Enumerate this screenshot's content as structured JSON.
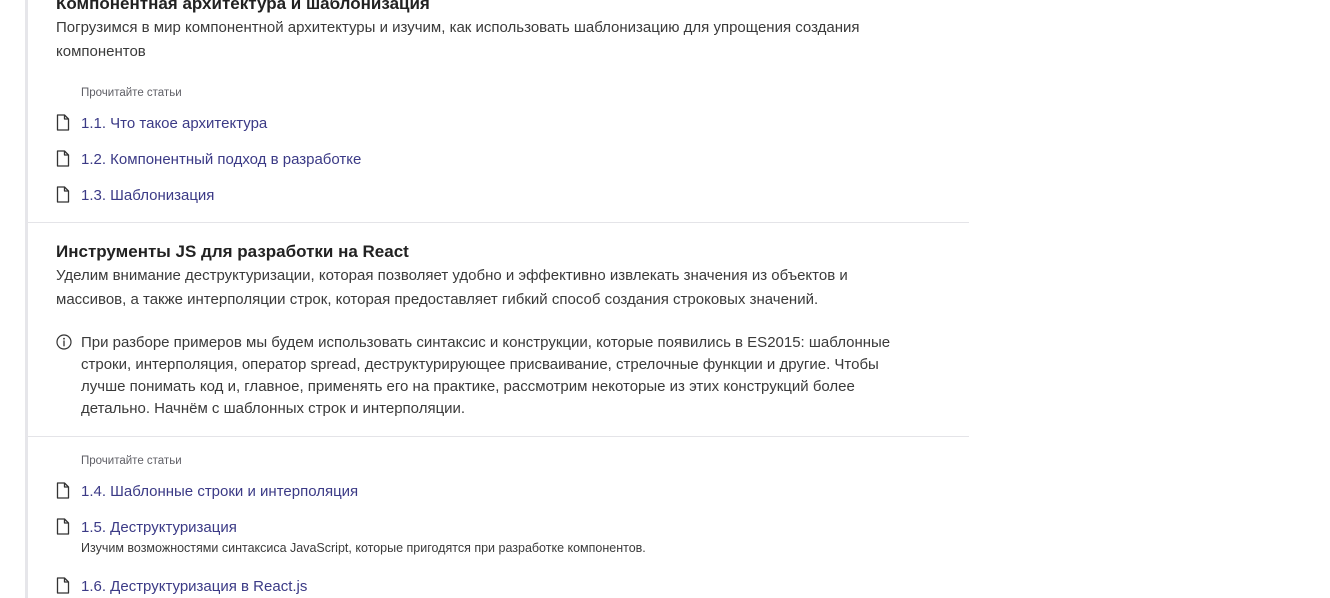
{
  "sections": [
    {
      "title": "Компонентная архитектура и шаблонизация",
      "description_lines": [
        "Погрузимся в мир компонентной архитектуры и изучим, как использовать шаблонизацию для упрощения создания",
        "компонентов"
      ],
      "read_label": "Прочитайте статьи",
      "articles": [
        {
          "title": "1.1. Что такое архитектура",
          "icon": "document-icon"
        },
        {
          "title": "1.2. Компонентный подход в разработке",
          "icon": "document-icon"
        },
        {
          "title": "1.3. Шаблонизация",
          "icon": "document-icon"
        }
      ]
    },
    {
      "title": "Инструменты JS для разработки на React",
      "description_lines": [
        "Уделим внимание деструктуризации, которая позволяет удобно и эффективно извлекать значения из объектов и",
        "массивов, а также интерполяции строк, которая предоставляет гибкий способ создания строковых значений."
      ],
      "note": {
        "icon": "info-icon",
        "lines": [
          "При разборе примеров мы будем использовать синтаксис и конструкции, которые появились в ES2015: шаблонные",
          "строки, интерполяция, оператор spread, деструктурирующее присваивание, стрелочные функции и другие. Чтобы",
          "лучше понимать код и, главное, применять его на практике, рассмотрим некоторые из этих конструкций более",
          "детально. Начнём с шаблонных строк и интерполяции."
        ]
      },
      "read_label": "Прочитайте статьи",
      "articles": [
        {
          "title": "1.4. Шаблонные строки и интерполяция",
          "icon": "document-icon"
        },
        {
          "title": "1.5. Деструктуризация",
          "icon": "document-icon",
          "subtitle": "Изучим возможностями синтаксиса JavaScript, которые пригодятся при разработке компонентов."
        },
        {
          "title": "1.6. Деструктуризация в React.js",
          "icon": "document-icon"
        }
      ]
    }
  ],
  "colors": {
    "link": "#3b3a86",
    "divider": "#e4e4e8",
    "left_rule": "#e6e6ea"
  }
}
